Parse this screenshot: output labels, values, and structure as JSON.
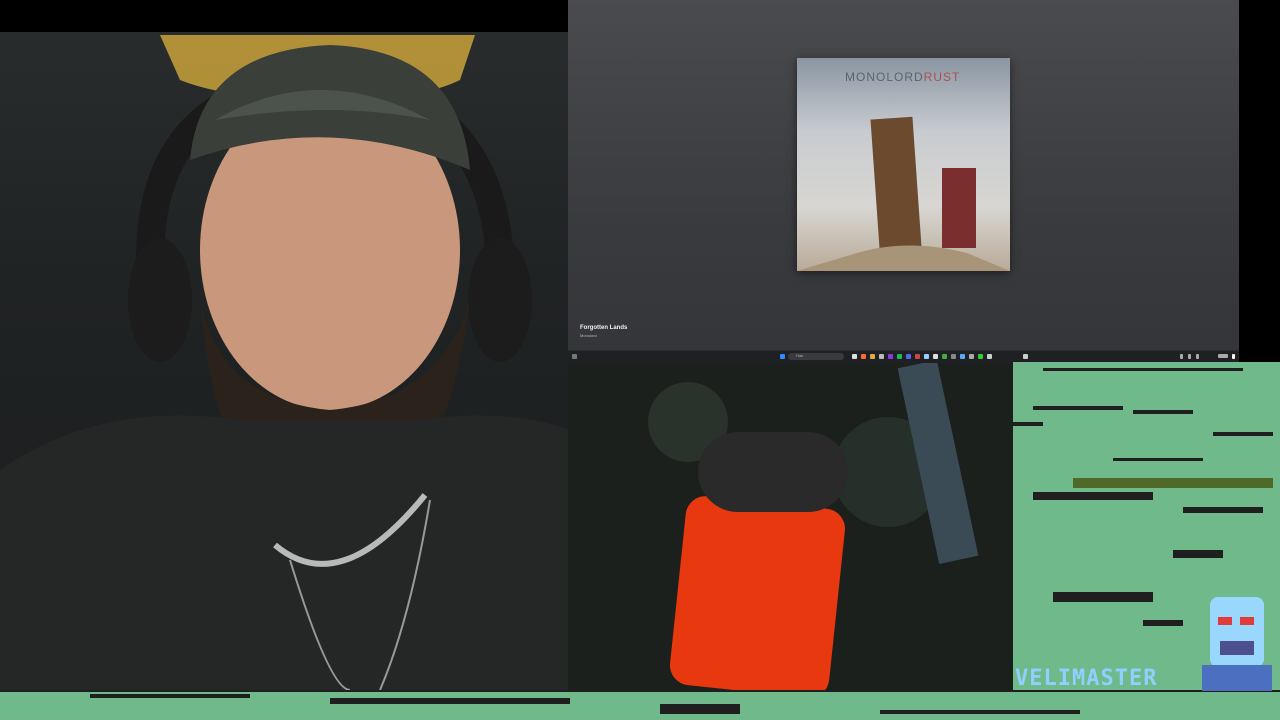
{
  "screen_share": {
    "album": {
      "art_title_main": "MONOLORD",
      "art_title_accent": "RUST"
    },
    "now_playing": {
      "title": "Forgotten Lands",
      "artist": "Monolord"
    },
    "taskbar": {
      "search_placeholder": "Hae"
    }
  },
  "overlay": {
    "brand": "VELIMASTER"
  },
  "colors": {
    "c64_green": "#6fb98a",
    "brand_blue": "#8fd0ff",
    "taskbar": "#1f2023"
  }
}
